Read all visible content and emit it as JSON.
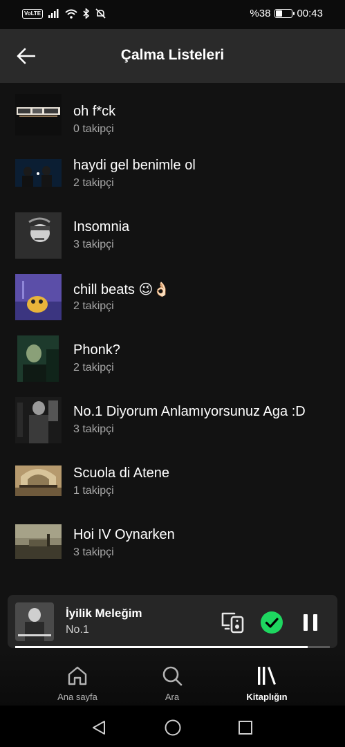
{
  "status": {
    "volte": "VoLTE",
    "battery_text": "%38",
    "battery_level": 0.38,
    "time": "00:43"
  },
  "header": {
    "title": "Çalma Listeleri"
  },
  "playlists": [
    {
      "title": "oh f*ck",
      "followers": "0 takipçi"
    },
    {
      "title": "haydi gel benimle ol",
      "followers": "2 takipçi"
    },
    {
      "title": "Insomnia",
      "followers": "3 takipçi"
    },
    {
      "title": "chill beats 😉👌🏻",
      "followers": "2 takipçi"
    },
    {
      "title": "Phonk?",
      "followers": "2 takipçi"
    },
    {
      "title": "No.1 Diyorum Anlamıyorsunuz Aga :D",
      "followers": "3 takipçi"
    },
    {
      "title": "Scuola di Atene",
      "followers": "1 takipçi"
    },
    {
      "title": "Hoi IV Oynarken",
      "followers": "3 takipçi"
    }
  ],
  "now_playing": {
    "title": "İyilik Meleğim",
    "artist": "No.1",
    "progress": 0.93,
    "saved_color": "#1ed760"
  },
  "nav": {
    "home": "Ana sayfa",
    "search": "Ara",
    "library": "Kitaplığın",
    "active": "library"
  }
}
